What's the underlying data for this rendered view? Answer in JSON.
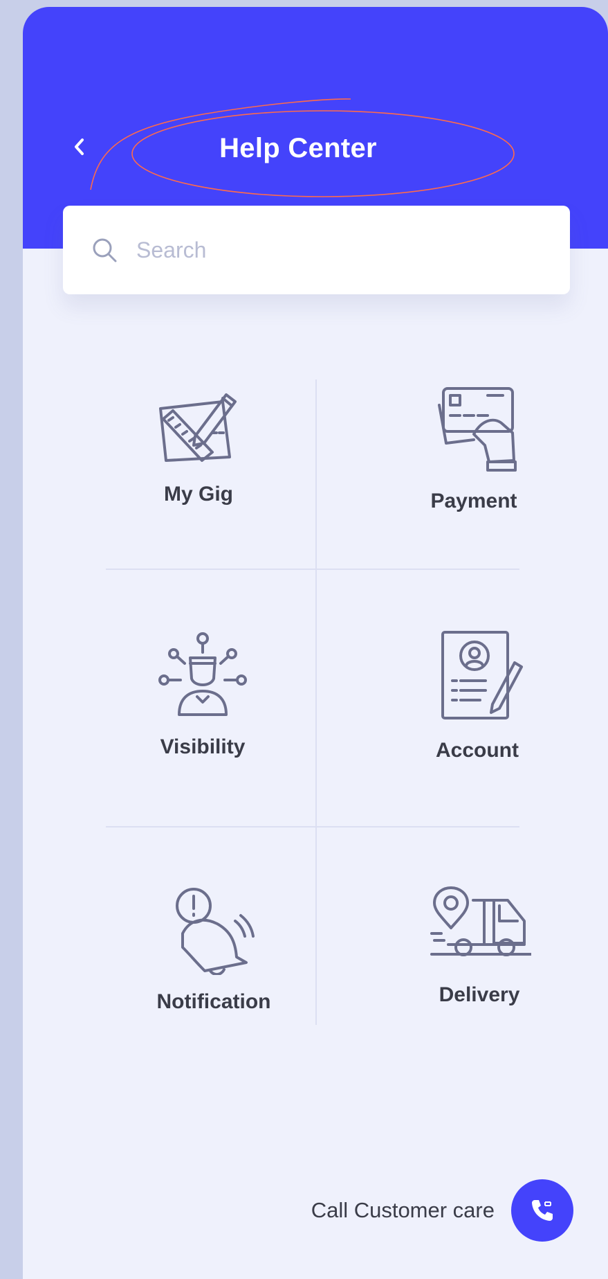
{
  "header": {
    "title": "Help Center",
    "back_icon": "chevron-left-icon"
  },
  "search": {
    "placeholder": "Search",
    "value": "",
    "icon": "search-icon"
  },
  "categories": [
    {
      "label": "My Gig",
      "icon": "design-tools-icon"
    },
    {
      "label": "Payment",
      "icon": "credit-card-hand-icon"
    },
    {
      "label": "Visibility",
      "icon": "person-network-icon"
    },
    {
      "label": "Account",
      "icon": "profile-document-icon"
    },
    {
      "label": "Notification",
      "icon": "alert-bell-icon"
    },
    {
      "label": "Delivery",
      "icon": "delivery-truck-icon"
    }
  ],
  "footer": {
    "call_label": "Call Customer care",
    "call_icon": "phone-icon"
  },
  "colors": {
    "accent": "#4443fb",
    "background": "#eff1fc",
    "icon_stroke": "#6b6e8c"
  }
}
